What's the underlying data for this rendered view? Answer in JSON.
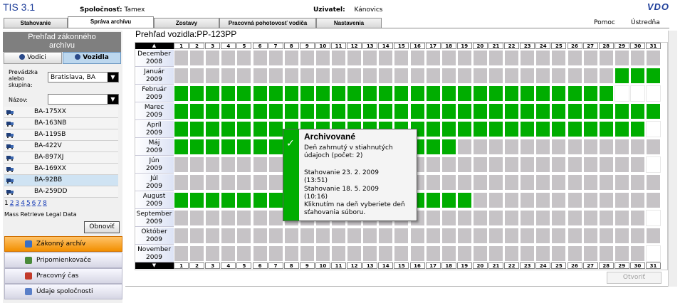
{
  "app": {
    "title": "TIS 3.1",
    "company_label": "Spoločnosť:",
    "company_value": "Tamex",
    "user_label": "Uzivatel:",
    "user_value": "Kánovics",
    "brand": "VDO"
  },
  "tabs": [
    {
      "label": "Stahovanie",
      "active": false
    },
    {
      "label": "Správa archívu",
      "active": true
    },
    {
      "label": "Zostavy",
      "active": false
    },
    {
      "label": "Pracovná pohotovosť vodiča",
      "active": false
    },
    {
      "label": "Nastavenia",
      "active": false
    }
  ],
  "top_links": {
    "help": "Pomoc",
    "headquarters": "Ústredňa"
  },
  "left": {
    "title_line1": "Prehľad zákonného",
    "title_line2": "archívu",
    "btn_drivers": "Vodici",
    "btn_vehicles": "Vozidla",
    "group_label": "Prevádzka alebo skupina:",
    "group_value": "Bratislava, BA",
    "name_label": "Názov:",
    "name_value": "",
    "vehicles": [
      "BA-175XX",
      "BA-163NB",
      "BA-119SB",
      "BA-422V",
      "BA-897XJ",
      "BA-169XX",
      "BA-92BB",
      "BA-259DD"
    ],
    "selected_vehicle_index": 6,
    "pages": [
      "1",
      "2",
      "3",
      "4",
      "5",
      "6",
      "7",
      "8"
    ],
    "current_page": "1",
    "mass_retrieve": "Mass Retrieve Legal Data",
    "refresh": "Obnoviť"
  },
  "menu": [
    {
      "label": "Zákonný archív",
      "active": true,
      "icon": "archive-icon",
      "color": "#3a6fc4"
    },
    {
      "label": "Pripomienkovače",
      "active": false,
      "icon": "reminder-icon",
      "color": "#4a8a3a"
    },
    {
      "label": "Pracovný čas",
      "active": false,
      "icon": "clock-icon",
      "color": "#c23a2a"
    },
    {
      "label": "Údaje spoločnosti",
      "active": false,
      "icon": "company-icon",
      "color": "#5a7fc8"
    }
  ],
  "main": {
    "title": "Prehľad vozidla:",
    "vehicle": "PP-123PP",
    "open_button": "Otvoriť"
  },
  "calendar": {
    "days": [
      "1",
      "2",
      "3",
      "4",
      "5",
      "6",
      "7",
      "8",
      "9",
      "10",
      "11",
      "12",
      "13",
      "14",
      "15",
      "16",
      "17",
      "18",
      "19",
      "20",
      "21",
      "22",
      "23",
      "24",
      "25",
      "26",
      "27",
      "28",
      "29",
      "30",
      "31"
    ],
    "up_arrow": "▲",
    "down_arrow": "▼",
    "months": [
      {
        "name": "December",
        "year": "2008",
        "days_in_month": 31,
        "archived": []
      },
      {
        "name": "Január",
        "year": "2009",
        "days_in_month": 31,
        "archived": [
          29,
          30,
          31
        ]
      },
      {
        "name": "Február",
        "year": "2009",
        "days_in_month": 28,
        "archived": [
          1,
          2,
          3,
          4,
          5,
          6,
          7,
          8,
          9,
          10,
          11,
          12,
          13,
          14,
          15,
          16,
          17,
          18,
          19,
          20,
          21,
          22,
          23,
          24,
          25,
          26,
          27,
          28
        ]
      },
      {
        "name": "Marec",
        "year": "2009",
        "days_in_month": 31,
        "archived": [
          1,
          2,
          3,
          4,
          5,
          6,
          7,
          8,
          9,
          10,
          11,
          12,
          13,
          14,
          15,
          16,
          17,
          18,
          19,
          20,
          21,
          22,
          23,
          24,
          25,
          26,
          27,
          28,
          29,
          30,
          31
        ]
      },
      {
        "name": "Apríl",
        "year": "2009",
        "days_in_month": 30,
        "archived": [
          1,
          2,
          3,
          4,
          5,
          6,
          7,
          8,
          9,
          10,
          11,
          12,
          13,
          14,
          15,
          16,
          17,
          18,
          19,
          20,
          21,
          22,
          23,
          24,
          25,
          26,
          27,
          28,
          29,
          30
        ]
      },
      {
        "name": "Máj",
        "year": "2009",
        "days_in_month": 31,
        "archived": [
          1,
          2,
          3,
          4,
          5,
          6,
          7,
          8,
          9,
          10,
          11,
          12,
          13,
          14,
          15,
          16,
          17,
          18
        ]
      },
      {
        "name": "Jún",
        "year": "2009",
        "days_in_month": 30,
        "archived": []
      },
      {
        "name": "Júl",
        "year": "2009",
        "days_in_month": 31,
        "archived": []
      },
      {
        "name": "August",
        "year": "2009",
        "days_in_month": 31,
        "archived": [
          1,
          2,
          3,
          4,
          5,
          6,
          7,
          8,
          9,
          10,
          11,
          12,
          13,
          14,
          15,
          16,
          17,
          18,
          19
        ]
      },
      {
        "name": "September",
        "year": "2009",
        "days_in_month": 30,
        "archived": []
      },
      {
        "name": "Október",
        "year": "2009",
        "days_in_month": 31,
        "archived": []
      },
      {
        "name": "November",
        "year": "2009",
        "days_in_month": 30,
        "archived": []
      }
    ]
  },
  "tooltip": {
    "title": "Archivované",
    "line1": "Deň zahrnutý v stiahnutých údajoch (počet: 2)",
    "line2": "Stahovanie 23. 2. 2009 (13:51)",
    "line3": "Stahovanie 18. 5. 2009 (10:16)",
    "line4": "Kliknutím na deň vyberiete deň sťahovania súboru.",
    "check": "✓"
  },
  "colors": {
    "archived": "#00ad00",
    "empty": "#c6c3c6",
    "accent": "#1f3f9a",
    "active_menu": "#f28f00"
  }
}
